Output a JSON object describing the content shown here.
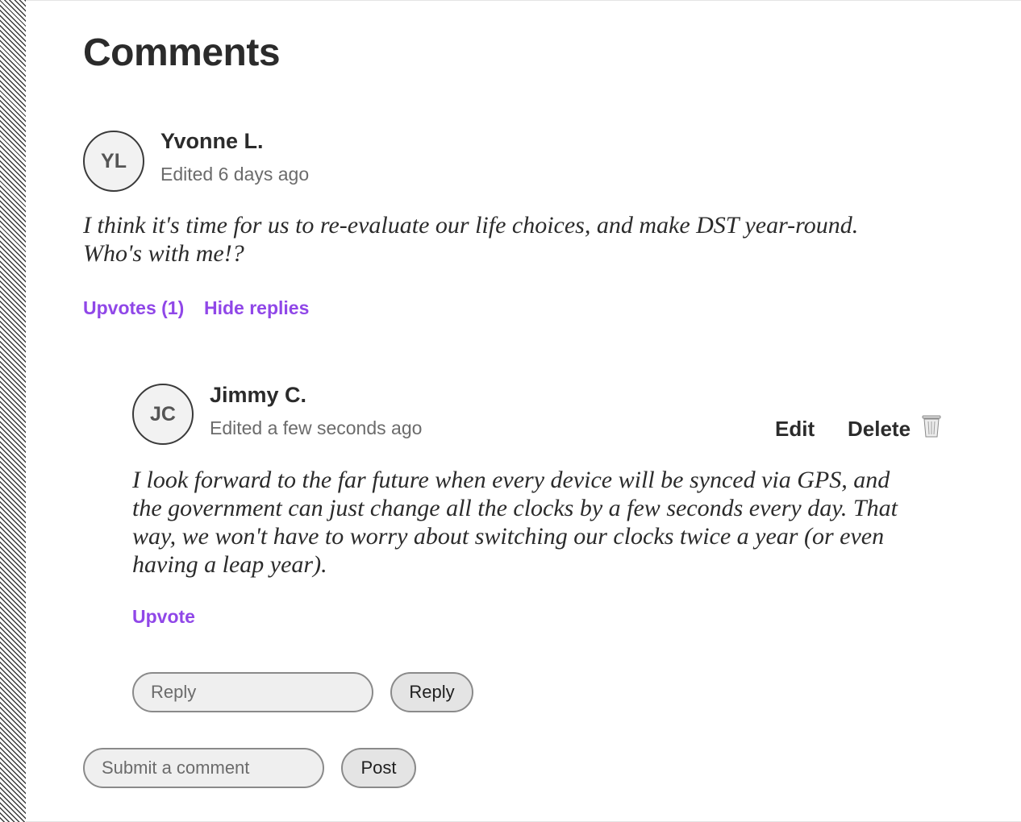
{
  "page": {
    "title": "Comments"
  },
  "comment": {
    "avatar_initials": "YL",
    "author": "Yvonne L.",
    "meta": "Edited 6 days ago",
    "body_line1": "I think it's time for us to re-evaluate our life choices, and make DST year-round.",
    "body_line2": "Who's with me!?",
    "upvotes_label": "Upvotes (1)",
    "hide_replies_label": "Hide replies"
  },
  "reply": {
    "avatar_initials": "JC",
    "author": "Jimmy C.",
    "meta": "Edited a few seconds ago",
    "edit_label": "Edit",
    "delete_label": "Delete",
    "delete_icon": "trash-icon",
    "body_line1": "I look forward to the far future when every device will be synced via GPS, and",
    "body_line2": "the government can just change all the clocks by a few seconds every day. That",
    "body_line3": "way, we won't have to worry about switching our clocks twice a year (or even",
    "body_line4": "having a leap year).",
    "upvote_label": "Upvote"
  },
  "reply_form": {
    "placeholder": "Reply",
    "button_label": "Reply"
  },
  "comment_form": {
    "placeholder": "Submit a comment",
    "button_label": "Post"
  },
  "colors": {
    "link": "#9047e8",
    "text": "#2b2b2b",
    "muted": "#6b6b6b"
  }
}
